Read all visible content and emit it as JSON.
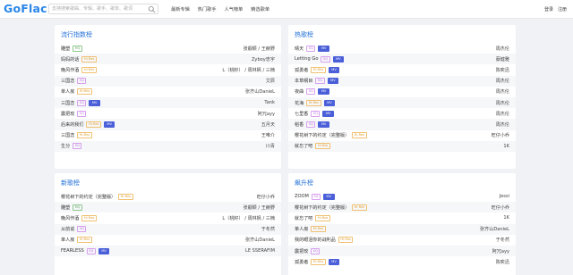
{
  "header": {
    "logo": "GoFlac",
    "search_placeholder": "支持搜索歌曲、专辑、歌手、歌单、歌词",
    "nav": [
      "最新专辑",
      "热门歌手",
      "人气榜单",
      "精选歌单"
    ],
    "login": "登录",
    "register": "注册"
  },
  "panels": [
    {
      "title": "流行指数榜",
      "rows": [
        {
          "song": "雕塑",
          "badges": [
            "HQ"
          ],
          "artist": "张靓颖 / 王赫野"
        },
        {
          "song": "妈妈的话",
          "badges": [
            "Hi-Res"
          ],
          "artist": "Zyboy忠宇"
        },
        {
          "song": "晚风作酒",
          "badges": [
            "Hi-Res"
          ],
          "artist": "L（桃籽） / 周林枫 / 三楠"
        },
        {
          "song": "三国恋",
          "badges": [
            "SQ"
          ],
          "artist": "艾辰"
        },
        {
          "song": "单人房",
          "badges": [
            "Hi-Res"
          ],
          "artist": "张齐山DanieL"
        },
        {
          "song": "三国恋",
          "badges": [
            "SQ",
            "MV"
          ],
          "artist": "Tank"
        },
        {
          "song": "震把玫",
          "badges": [
            "SQ"
          ],
          "artist": "阿冗ayy"
        },
        {
          "song": "后来的我们",
          "badges": [
            "Hi-Res",
            "MV"
          ],
          "artist": "五月天"
        },
        {
          "song": "三国恋",
          "badges": [
            "Hi-Res"
          ],
          "artist": "王唯介"
        },
        {
          "song": "生分",
          "badges": [
            "SQ"
          ],
          "artist": "川青"
        }
      ]
    },
    {
      "title": "热歌榜",
      "rows": [
        {
          "song": "晴天",
          "badges": [
            "SQ",
            "MV"
          ],
          "artist": "周杰伦"
        },
        {
          "song": "Letting Go",
          "badges": [
            "SQ",
            "MV"
          ],
          "artist": "蔡健雅"
        },
        {
          "song": "孤勇者",
          "badges": [
            "Hi-Res",
            "MV"
          ],
          "artist": "陈奕迅"
        },
        {
          "song": "本草纲目",
          "badges": [
            "SQ",
            "MV"
          ],
          "artist": "周杰伦"
        },
        {
          "song": "夜曲",
          "badges": [
            "SQ",
            "MV"
          ],
          "artist": "周杰伦"
        },
        {
          "song": "花海",
          "badges": [
            "Hi-Res",
            "MV"
          ],
          "artist": "周杰伦"
        },
        {
          "song": "七里香",
          "badges": [
            "SQ",
            "MV"
          ],
          "artist": "周杰伦"
        },
        {
          "song": "稻香",
          "badges": [
            "SQ",
            "MV"
          ],
          "artist": "周杰伦"
        },
        {
          "song": "樱花树下的约定（完整版）",
          "badges": [
            "Hi-Res"
          ],
          "artist": "旺仔小乔"
        },
        {
          "song": "就忘了吧",
          "badges": [
            "Hi-Res"
          ],
          "artist": "1K"
        }
      ]
    },
    {
      "title": "新歌榜",
      "rows": [
        {
          "song": "樱花树下的约定（完整版）",
          "badges": [
            "Hi-Res"
          ],
          "artist": "旺仔小乔"
        },
        {
          "song": "雕塑",
          "badges": [
            "HQ"
          ],
          "artist": "张靓颖 / 王赫野"
        },
        {
          "song": "晚风作酒",
          "badges": [
            "Hi-Res"
          ],
          "artist": "L（桃籽） / 周林枫 / 三楠"
        },
        {
          "song": "从前说",
          "badges": [
            "SQ"
          ],
          "artist": "于冬然"
        },
        {
          "song": "单人房",
          "badges": [
            "Hi-Res"
          ],
          "artist": "张齐山DanieL"
        },
        {
          "song": "FEARLESS",
          "badges": [
            "SQ",
            "MV"
          ],
          "artist": "LE SSERAFIM"
        }
      ]
    },
    {
      "title": "飙升榜",
      "rows": [
        {
          "song": "ZOOM",
          "badges": [
            "SQ",
            "MV"
          ],
          "artist": "Jessi"
        },
        {
          "song": "樱花树下的约定（完整版）",
          "badges": [
            "Hi-Res"
          ],
          "artist": "旺仔小乔"
        },
        {
          "song": "就忘了吧",
          "badges": [
            "Hi-Res"
          ],
          "artist": "1K"
        },
        {
          "song": "单人房",
          "badges": [
            "Hi-Res"
          ],
          "artist": "张齐山DanieL"
        },
        {
          "song": "我的眼泪你的战利品",
          "badges": [
            "Hi-Res"
          ],
          "artist": "于冬然"
        },
        {
          "song": "震把玫",
          "badges": [
            "SQ"
          ],
          "artist": "阿冗ayy"
        },
        {
          "song": "孤勇者",
          "badges": [
            "Hi-Res",
            "MV"
          ],
          "artist": "陈奕迅"
        }
      ]
    }
  ]
}
